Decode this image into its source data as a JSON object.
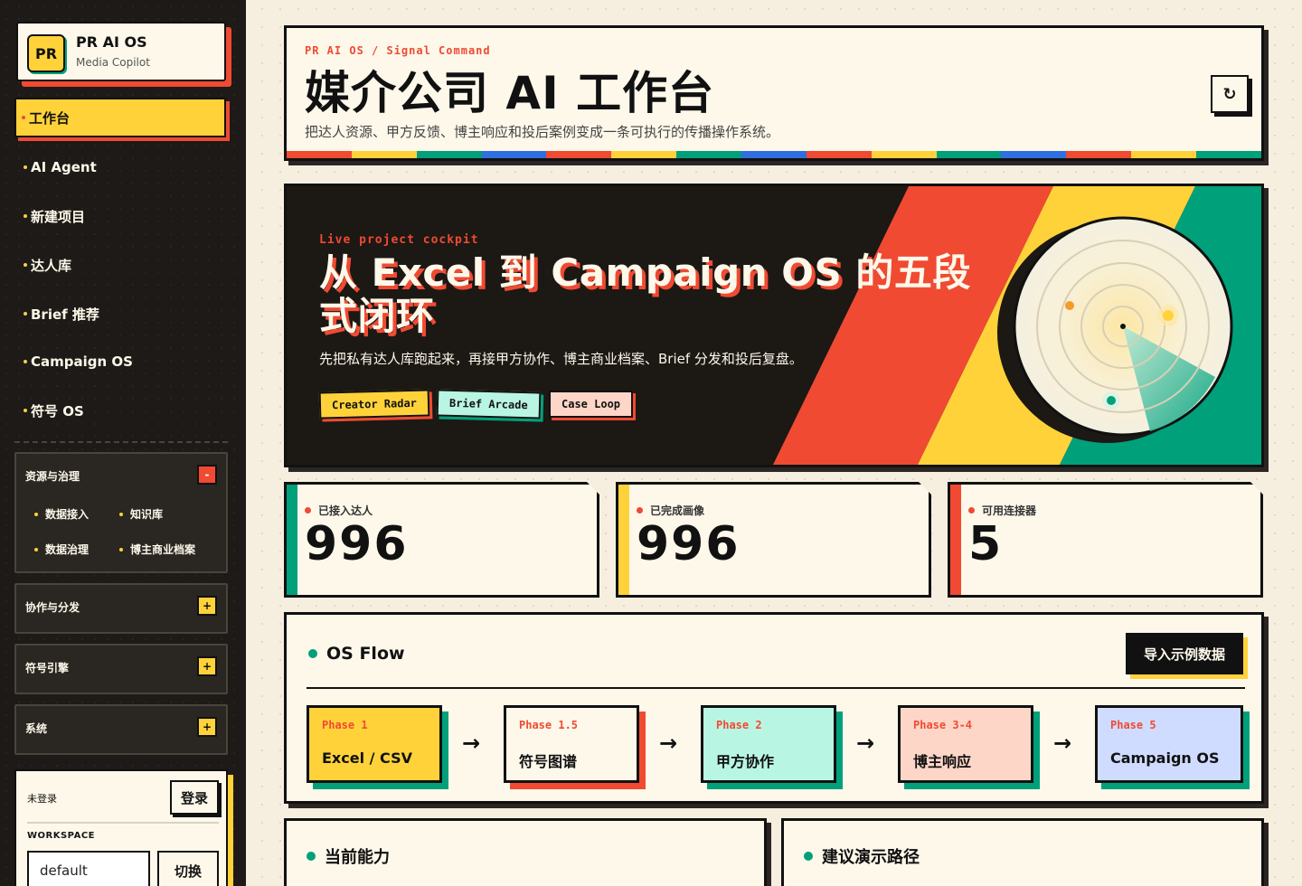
{
  "brand": {
    "logo": "PR",
    "title": "PR AI OS",
    "subtitle": "Media Copilot"
  },
  "nav": [
    {
      "label": "工作台",
      "active": true
    },
    {
      "label": "AI Agent"
    },
    {
      "label": "新建项目"
    },
    {
      "label": "达人库"
    },
    {
      "label": "Brief 推荐"
    },
    {
      "label": "Campaign OS"
    },
    {
      "label": "符号 OS"
    }
  ],
  "groups": {
    "resources": {
      "title": "资源与治理",
      "toggle": "-",
      "items": [
        "数据接入",
        "知识库",
        "数据治理",
        "博主商业档案"
      ]
    },
    "collab": {
      "title": "协作与分发",
      "toggle": "+"
    },
    "symbol": {
      "title": "符号引擎",
      "toggle": "+"
    },
    "system": {
      "title": "系统",
      "toggle": "+"
    }
  },
  "login": {
    "status": "未登录",
    "login_label": "登录",
    "workspace_label": "WORKSPACE",
    "workspace_value": "default",
    "switch_label": "切换"
  },
  "header": {
    "kicker": "PR AI OS / Signal Command",
    "title": "媒介公司 AI 工作台",
    "description": "把达人资源、甲方反馈、博主响应和投后案例变成一条可执行的传播操作系统。",
    "refresh_icon": "refresh-icon",
    "refresh_glyph": "↻"
  },
  "hero": {
    "kicker": "Live project cockpit",
    "title": "从 Excel 到 Campaign OS 的五段式闭环",
    "description": "先把私有达人库跑起来，再接甲方协作、博主商业档案、Brief 分发和投后复盘。",
    "chips": [
      "Creator Radar",
      "Brief Arcade",
      "Case Loop"
    ]
  },
  "stats": [
    {
      "label": "已接入达人",
      "value": "996",
      "color": "#00a07a"
    },
    {
      "label": "已完成画像",
      "value": "996",
      "color": "#ffd23a"
    },
    {
      "label": "可用连接器",
      "value": "5",
      "color": "#f04a32"
    }
  ],
  "flow": {
    "title": "OS Flow",
    "import_label": "导入示例数据",
    "arrow": "→",
    "phases": [
      {
        "num": "Phase 1",
        "name": "Excel / CSV",
        "bg": "#ffd23a",
        "shadow": "#00a07a"
      },
      {
        "num": "Phase 1.5",
        "name": "符号图谱",
        "bg": "#fdf8ea",
        "shadow": "#f04a32"
      },
      {
        "num": "Phase 2",
        "name": "甲方协作",
        "bg": "#b9f5e3",
        "shadow": "#00a07a"
      },
      {
        "num": "Phase 3-4",
        "name": "博主响应",
        "bg": "#fdd6c8",
        "shadow": "#00a07a"
      },
      {
        "num": "Phase 5",
        "name": "Campaign OS",
        "bg": "#cfdcff",
        "shadow": "#00a07a"
      }
    ]
  },
  "sections": {
    "capability": "当前能力",
    "demo_path": "建议演示路径"
  },
  "colors": {
    "red": "#f04a32",
    "yellow": "#ffd23a",
    "green": "#00a07a",
    "blue": "#2f6fe0",
    "dark": "#1c1814",
    "paper": "#fdf8ea"
  }
}
